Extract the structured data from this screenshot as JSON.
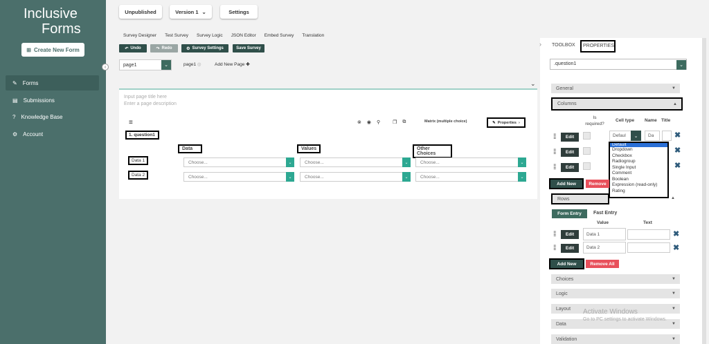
{
  "brand": {
    "line1": "Inclusive",
    "line2": "Forms"
  },
  "sidebar": {
    "create_label": "Create New Form",
    "items": [
      {
        "label": "Forms",
        "icon": "edit-icon"
      },
      {
        "label": "Submissions",
        "icon": "document-icon"
      },
      {
        "label": "Knowledge Base",
        "icon": "help-icon"
      },
      {
        "label": "Account",
        "icon": "gear-icon"
      }
    ]
  },
  "topbar": {
    "unpublished": "Unpublished",
    "version": "Version 1",
    "settings": "Settings"
  },
  "designer_tabs": [
    "Survey Designer",
    "Test Survey",
    "Survey Logic",
    "JSON Editor",
    "Embed Survey",
    "Translation"
  ],
  "toolbar": {
    "undo": "Undo",
    "redo": "Redo",
    "survey_settings": "Survey Settings",
    "save_survey": "Save Survey"
  },
  "pages": {
    "selected": "page1",
    "tab": "page1",
    "add_page": "Add New Page"
  },
  "canvas": {
    "title_placeholder": "Input page title here",
    "desc_placeholder": "Enter a page description",
    "question_type": "Matrix (multiple choice)",
    "properties_label": "Properties",
    "question_title": "1. question1",
    "columns": [
      "Data",
      "Values",
      "Other Choices"
    ],
    "rows": [
      "Data 1",
      "Data 2"
    ],
    "choose": "Choose..."
  },
  "right": {
    "toolbox_tab": "TOOLBOX",
    "properties_tab": "PROPERTIES",
    "object_selector": ".question1",
    "sections": {
      "general": "General",
      "columns": "Columns",
      "rows": "Rows",
      "choices": "Choices",
      "logic": "Logic",
      "layout": "Layout",
      "data": "Data",
      "validation": "Validation"
    },
    "columns_header": {
      "is_required": "Is required?",
      "cell_type": "Cell type",
      "name": "Name",
      "title": "Title"
    },
    "edit": "Edit",
    "add_new": "Add New",
    "remove": "Remove",
    "remove_all": "Remove All",
    "cell_type_value": "Defaul",
    "name_value": "Da",
    "dropdown_options": [
      "Default",
      "Dropdown",
      "Checkbox",
      "Radiogroup",
      "Single Input",
      "Comment",
      "Boolean",
      "Expression (read-only)",
      "Rating"
    ],
    "rows_tabs": {
      "form_entry": "Form Entry",
      "fast_entry": "Fast Entry"
    },
    "rows_header": {
      "value": "Value",
      "text": "Text"
    },
    "row_values": [
      "Data 1",
      "Data 2"
    ]
  },
  "watermark": {
    "line1": "Activate Windows",
    "line2": "Go to PC settings to activate Windows."
  },
  "colors": {
    "sidebar": "#4b6f6b",
    "accent": "#2da892",
    "dark_button": "#2f3d3b",
    "remove": "#e8505b"
  }
}
